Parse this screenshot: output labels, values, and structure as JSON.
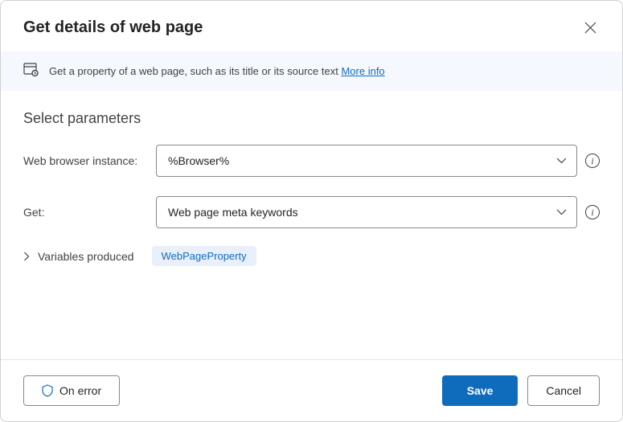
{
  "dialog": {
    "title": "Get details of web page"
  },
  "info": {
    "text": "Get a property of a web page, such as its title or its source text",
    "more_link": "More info"
  },
  "section": {
    "title": "Select parameters"
  },
  "fields": {
    "browser": {
      "label": "Web browser instance:",
      "value": "%Browser%"
    },
    "get": {
      "label": "Get:",
      "value": "Web page meta keywords"
    }
  },
  "variables": {
    "label": "Variables produced",
    "badge": "WebPageProperty"
  },
  "buttons": {
    "on_error": "On error",
    "save": "Save",
    "cancel": "Cancel"
  }
}
